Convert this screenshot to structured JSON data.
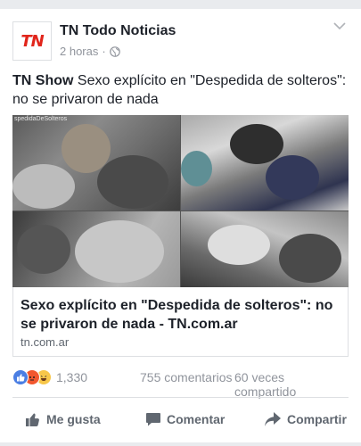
{
  "post": {
    "page_name": "TN Todo Noticias",
    "logo_text": "TN",
    "time": "2 horas",
    "separator": "·",
    "text_bold": "TN Show",
    "text": "Sexo explícito en \"Despedida de solteros\": no se privaron de nada"
  },
  "media": {
    "tile_label": "spedidaDeSolteros"
  },
  "link": {
    "title": "Sexo explícito en \"Despedida de solteros\": no se privaron de nada - TN.com.ar",
    "domain": "tn.com.ar"
  },
  "stats": {
    "reactions": [
      "like-icon",
      "angry-icon",
      "haha-icon"
    ],
    "reaction_count": "1,330",
    "comments": "755 comentarios",
    "shares": "60 veces compartido"
  },
  "actions": {
    "like": "Me gusta",
    "comment": "Comentar",
    "share": "Compartir"
  },
  "colors": {
    "brand_red": "#e1251b",
    "like_blue": "#4a7ee3",
    "muted": "#90949c"
  }
}
